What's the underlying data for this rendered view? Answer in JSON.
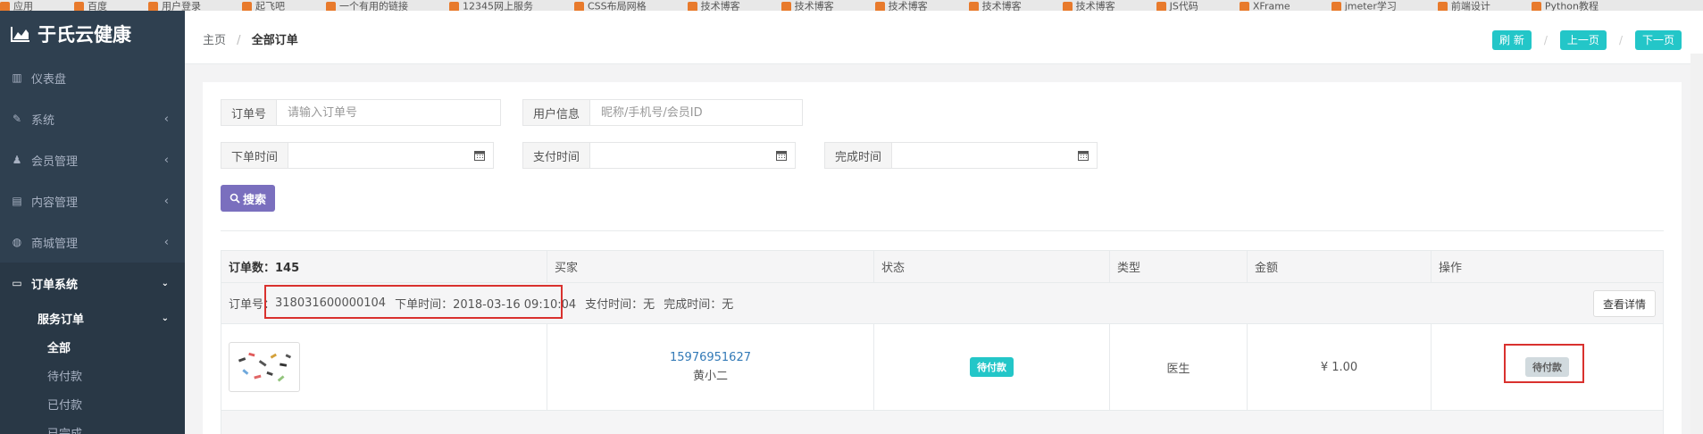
{
  "bookmarks": [
    "应用",
    "百度",
    "用户登录",
    "起飞吧",
    "一个有用的链接",
    "12345网上服务",
    "CSS布局网格",
    "技术博客",
    "技术博客",
    "技术博客",
    "技术博客",
    "技术博客",
    "JS代码",
    "XFrame",
    "jmeter学习",
    "前端设计",
    "Python教程"
  ],
  "sidebar": {
    "brand": "于氏云健康",
    "items": [
      {
        "label": "仪表盘",
        "icon": "bar-chart-icon",
        "glyph": "▥",
        "arrow": ""
      },
      {
        "label": "系统",
        "icon": "wrench-icon",
        "glyph": "✎",
        "arrow": "‹"
      },
      {
        "label": "会员管理",
        "icon": "users-icon",
        "glyph": "♟",
        "arrow": "‹"
      },
      {
        "label": "内容管理",
        "icon": "book-icon",
        "glyph": "▤",
        "arrow": "‹"
      },
      {
        "label": "商城管理",
        "icon": "globe-icon",
        "glyph": "◍",
        "arrow": "‹"
      },
      {
        "label": "订单系统",
        "icon": "laptop-icon",
        "glyph": "▭",
        "arrow": "⌄"
      }
    ],
    "submenu": {
      "title": "服务订单",
      "arrow": "⌄",
      "items": [
        "全部",
        "待付款",
        "已付款",
        "已完成"
      ]
    }
  },
  "header": {
    "breadcrumb_home": "主页",
    "breadcrumb_sep": "/",
    "breadcrumb_current": "全部订单",
    "refresh_label": "刷 新",
    "prev_label": "上一页",
    "next_label": "下一页"
  },
  "filters": {
    "order_no_label": "订单号",
    "order_no_placeholder": "请输入订单号",
    "user_label": "用户信息",
    "user_placeholder": "昵称/手机号/会员ID",
    "order_time_label": "下单时间",
    "pay_time_label": "支付时间",
    "finish_time_label": "完成时间",
    "search_label": "搜索"
  },
  "table": {
    "headers": [
      "订单数：145",
      "买家",
      "状态",
      "类型",
      "金额",
      "操作"
    ],
    "order": {
      "meta_prefix": "订单号：",
      "order_no": "318031600000104",
      "order_time_text": "下单时间：2018-03-16 09:10:04",
      "pay_time_text": "支付时间：无",
      "finish_time_text": "完成时间：无",
      "detail_label": "查看详情",
      "buyer_phone": "15976951627",
      "buyer_name": "黄小二",
      "status": "待付款",
      "type": "医生",
      "amount": "¥ 1.00",
      "action": "待付款"
    }
  },
  "colors": {
    "sidebar_bg": "#2f4050",
    "accent_teal": "#23c6c8",
    "search_purple": "#7a6fbe",
    "highlight_red": "#d9312e"
  }
}
